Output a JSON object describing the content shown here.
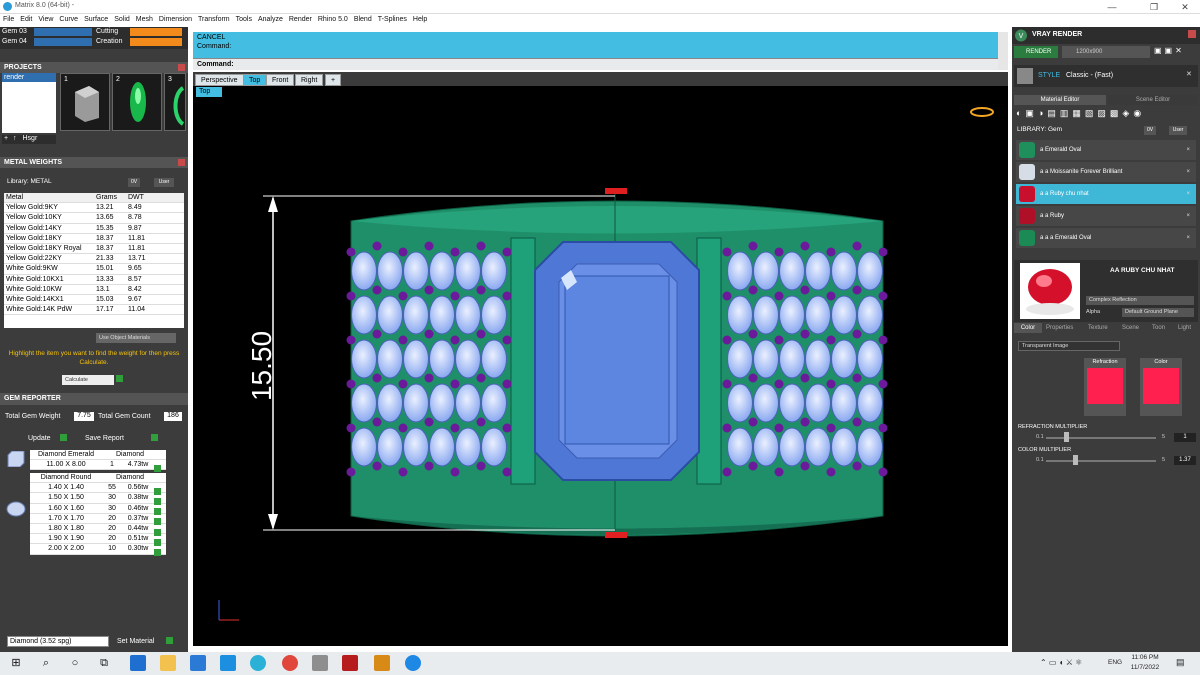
{
  "window": {
    "title": "Matrix 8.0 (64-bit) -",
    "controls": [
      "—",
      "❐",
      "✕"
    ]
  },
  "menu": [
    "File",
    "Edit",
    "View",
    "Curve",
    "Surface",
    "Solid",
    "Mesh",
    "Dimension",
    "Transform",
    "Tools",
    "Analyze",
    "Render",
    "Rhino 5.0",
    "Blend",
    "T-Splines",
    "Help"
  ],
  "layers": [
    {
      "name": "Gem 03"
    },
    {
      "name": "Gem 04"
    },
    {
      "name": "Cutting"
    },
    {
      "name": "Creation"
    }
  ],
  "projects": {
    "header": "PROJECTS",
    "items": [
      "render"
    ],
    "thumb_numbers": [
      "1",
      "2",
      "3"
    ],
    "toolbar_label": "Hsgr"
  },
  "metal_weights": {
    "header": "METAL WEIGHTS",
    "library_label": "Library: METAL",
    "toggle_labels": [
      "0V",
      "User"
    ],
    "columns": [
      "Metal",
      "Grams",
      "DWT"
    ],
    "rows": [
      [
        "Yellow Gold:9KY",
        "13.21",
        "8.49"
      ],
      [
        "Yellow Gold:10KY",
        "13.65",
        "8.78"
      ],
      [
        "Yellow Gold:14KY",
        "15.35",
        "9.87"
      ],
      [
        "Yellow Gold:18KY",
        "18.37",
        "11.81"
      ],
      [
        "Yellow Gold:18KY Royal",
        "18.37",
        "11.81"
      ],
      [
        "Yellow Gold:22KY",
        "21.33",
        "13.71"
      ],
      [
        "White Gold:9KW",
        "15.01",
        "9.65"
      ],
      [
        "White Gold:10KX1",
        "13.33",
        "8.57"
      ],
      [
        "White Gold:10KW",
        "13.1",
        "8.42"
      ],
      [
        "White Gold:14KX1",
        "15.03",
        "9.67"
      ],
      [
        "White Gold:14K PdW",
        "17.17",
        "11.04"
      ]
    ],
    "use_object_materials": "Use Object Materials",
    "hint": "Highlight the item you want to find the weight for then press Calculate.",
    "calculate": "Calculate"
  },
  "gem_reporter": {
    "header": "GEM REPORTER",
    "total_weight_label": "Total Gem Weight",
    "total_weight": "7.75",
    "total_count_label": "Total Gem Count",
    "total_count": "186",
    "update": "Update",
    "save_report": "Save Report",
    "groups": [
      {
        "name": "Diamond Emerald",
        "type": "Diamond",
        "rows": [
          [
            "11.00 X 8.00",
            "1",
            "4.73tw"
          ]
        ]
      },
      {
        "name": "Diamond Round",
        "type": "Diamond",
        "rows": [
          [
            "1.40 X 1.40",
            "55",
            "0.56tw"
          ],
          [
            "1.50 X 1.50",
            "30",
            "0.38tw"
          ],
          [
            "1.60 X 1.60",
            "30",
            "0.46tw"
          ],
          [
            "1.70 X 1.70",
            "20",
            "0.37tw"
          ],
          [
            "1.80 X 1.80",
            "20",
            "0.44tw"
          ],
          [
            "1.90 X 1.90",
            "20",
            "0.51tw"
          ],
          [
            "2.00 X 2.00",
            "10",
            "0.30tw"
          ]
        ]
      }
    ],
    "material_select": "Diamond    (3.52 spg)",
    "set_material": "Set Material"
  },
  "command": {
    "line1": "CANCEL",
    "line2": "Command:",
    "prompt": "Command:"
  },
  "view_tabs": [
    "Perspective",
    "Top",
    "Front",
    "Right"
  ],
  "view_label": "Top",
  "dimension": "15.50",
  "vray": {
    "header": "VRAY RENDER",
    "render_button": "RENDER",
    "resolution": "1200x900",
    "style_label": "STYLE",
    "style_value": "Classic - (Fast)",
    "tabs": [
      "Material Editor",
      "Scene Editor"
    ],
    "library_label": "LIBRARY: Gem",
    "toggle_labels": [
      "0V",
      "User"
    ],
    "materials": [
      {
        "name": "a Emerald Oval",
        "color": "#1f8f5c"
      },
      {
        "name": "a a Moissanite Forever Brilliant",
        "color": "#d6dde6"
      },
      {
        "name": "a a Ruby chu nhat",
        "color": "#c8102e"
      },
      {
        "name": "a a Ruby",
        "color": "#b01027"
      },
      {
        "name": "a a a Emerald Oval",
        "color": "#1c8a55"
      }
    ],
    "selected_material": "AA RUBY CHU NHAT",
    "preset": "Complex Reflection",
    "alpha_label": "Alpha",
    "ground": "Default Ground Plane",
    "prop_tabs": [
      "Color",
      "Properties",
      "Texture",
      "Scene",
      "Toon",
      "Light"
    ],
    "mode": "Transparent Image",
    "swatch_labels": [
      "Refraction",
      "Color"
    ],
    "refraction_multiplier_label": "REFRACTION MULTIPLIER",
    "refraction_min": "0.1",
    "refraction_max": "5",
    "refraction_value": "1",
    "color_multiplier_label": "COLOR MULTIPLIER",
    "color_min": "0.1",
    "color_max": "5",
    "color_value": "1.37"
  },
  "taskbar": {
    "time": "11:06 PM",
    "date": "11/7/2022",
    "lang": "ENG"
  }
}
